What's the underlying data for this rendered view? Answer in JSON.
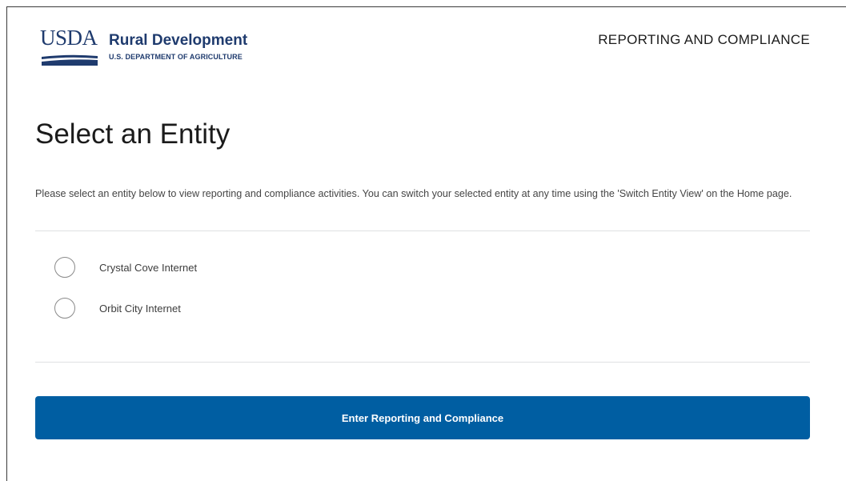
{
  "header": {
    "logo_text": "USDA",
    "agency_name": "Rural Development",
    "department": "U.S. DEPARTMENT OF AGRICULTURE",
    "section_title": "REPORTING AND COMPLIANCE"
  },
  "main": {
    "title": "Select an Entity",
    "instructions": "Please select an entity below to view reporting and compliance activities. You can switch your selected entity at any time using the 'Switch Entity View' on the Home page.",
    "entities": [
      {
        "label": "Crystal Cove Internet",
        "selected": false
      },
      {
        "label": "Orbit City Internet",
        "selected": false
      }
    ],
    "submit_label": "Enter Reporting and Compliance"
  },
  "colors": {
    "brand_navy": "#1f3b6e",
    "button_blue": "#005ea2",
    "divider": "#dfe1e2"
  }
}
